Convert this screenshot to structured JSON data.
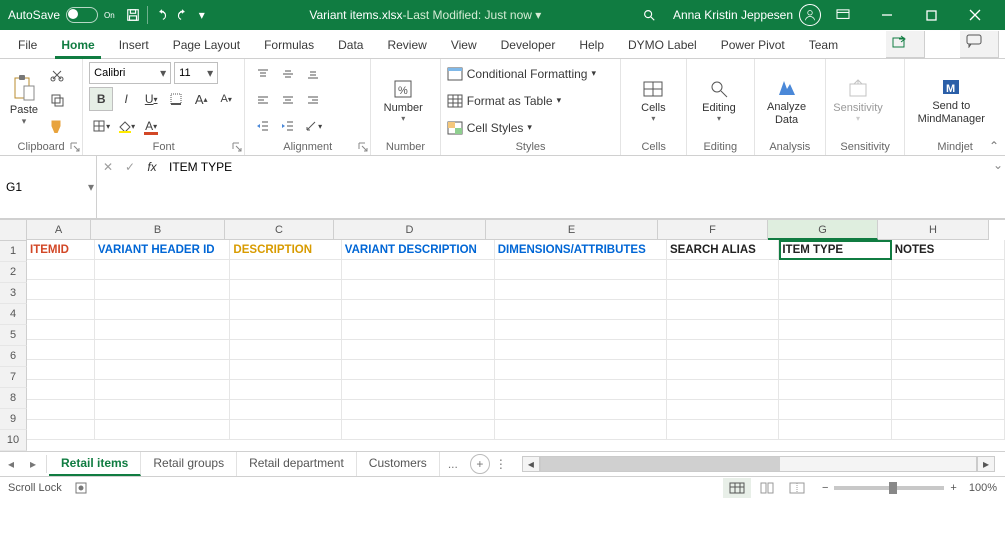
{
  "title": {
    "autosave": "AutoSave",
    "autostate": "On",
    "doc": "Variant items.xlsx",
    "sep": " - ",
    "modified": "Last Modified: Just now",
    "user": "Anna Kristin Jeppesen"
  },
  "tabs": [
    "File",
    "Home",
    "Insert",
    "Page Layout",
    "Formulas",
    "Data",
    "Review",
    "View",
    "Developer",
    "Help",
    "DYMO Label",
    "Power Pivot",
    "Team"
  ],
  "activeTab": "Home",
  "ribbon": {
    "clipboard": {
      "name": "Clipboard",
      "paste": "Paste"
    },
    "font": {
      "name": "Font",
      "face": "Calibri",
      "size": "11"
    },
    "alignment": {
      "name": "Alignment"
    },
    "number": {
      "name": "Number",
      "label": "Number"
    },
    "styles": {
      "name": "Styles",
      "cond": "Conditional Formatting",
      "fmt": "Format as Table",
      "cell": "Cell Styles"
    },
    "cells": {
      "name": "Cells",
      "label": "Cells"
    },
    "editing": {
      "name": "Editing",
      "label": "Editing"
    },
    "analysis": {
      "name": "Analysis",
      "label": "Analyze Data"
    },
    "sensitivity": {
      "name": "Sensitivity",
      "label": "Sensitivity"
    },
    "mindjet": {
      "name": "Mindjet",
      "label": "Send to MindManager"
    }
  },
  "namebox": "G1",
  "formula": "ITEM TYPE",
  "cols": [
    "A",
    "B",
    "C",
    "D",
    "E",
    "F",
    "G",
    "H"
  ],
  "rows": [
    "1",
    "2",
    "3",
    "4",
    "5",
    "6",
    "7",
    "8",
    "9",
    "10"
  ],
  "headersRow": [
    {
      "t": "ITEMID",
      "cls": "red"
    },
    {
      "t": "VARIANT HEADER ID",
      "cls": "blue"
    },
    {
      "t": "DESCRIPTION",
      "cls": "gold"
    },
    {
      "t": "VARIANT DESCRIPTION",
      "cls": "blue"
    },
    {
      "t": "DIMENSIONS/ATTRIBUTES",
      "cls": "blue"
    },
    {
      "t": "SEARCH ALIAS",
      "cls": ""
    },
    {
      "t": "ITEM TYPE",
      "cls": ""
    },
    {
      "t": "NOTES",
      "cls": ""
    }
  ],
  "selectedCol": "G",
  "sheets": [
    "Retail items",
    "Retail groups",
    "Retail department",
    "Customers"
  ],
  "activeSheet": "Retail items",
  "dots": "...",
  "status": {
    "scroll": "Scroll Lock",
    "zoom": "100%"
  }
}
